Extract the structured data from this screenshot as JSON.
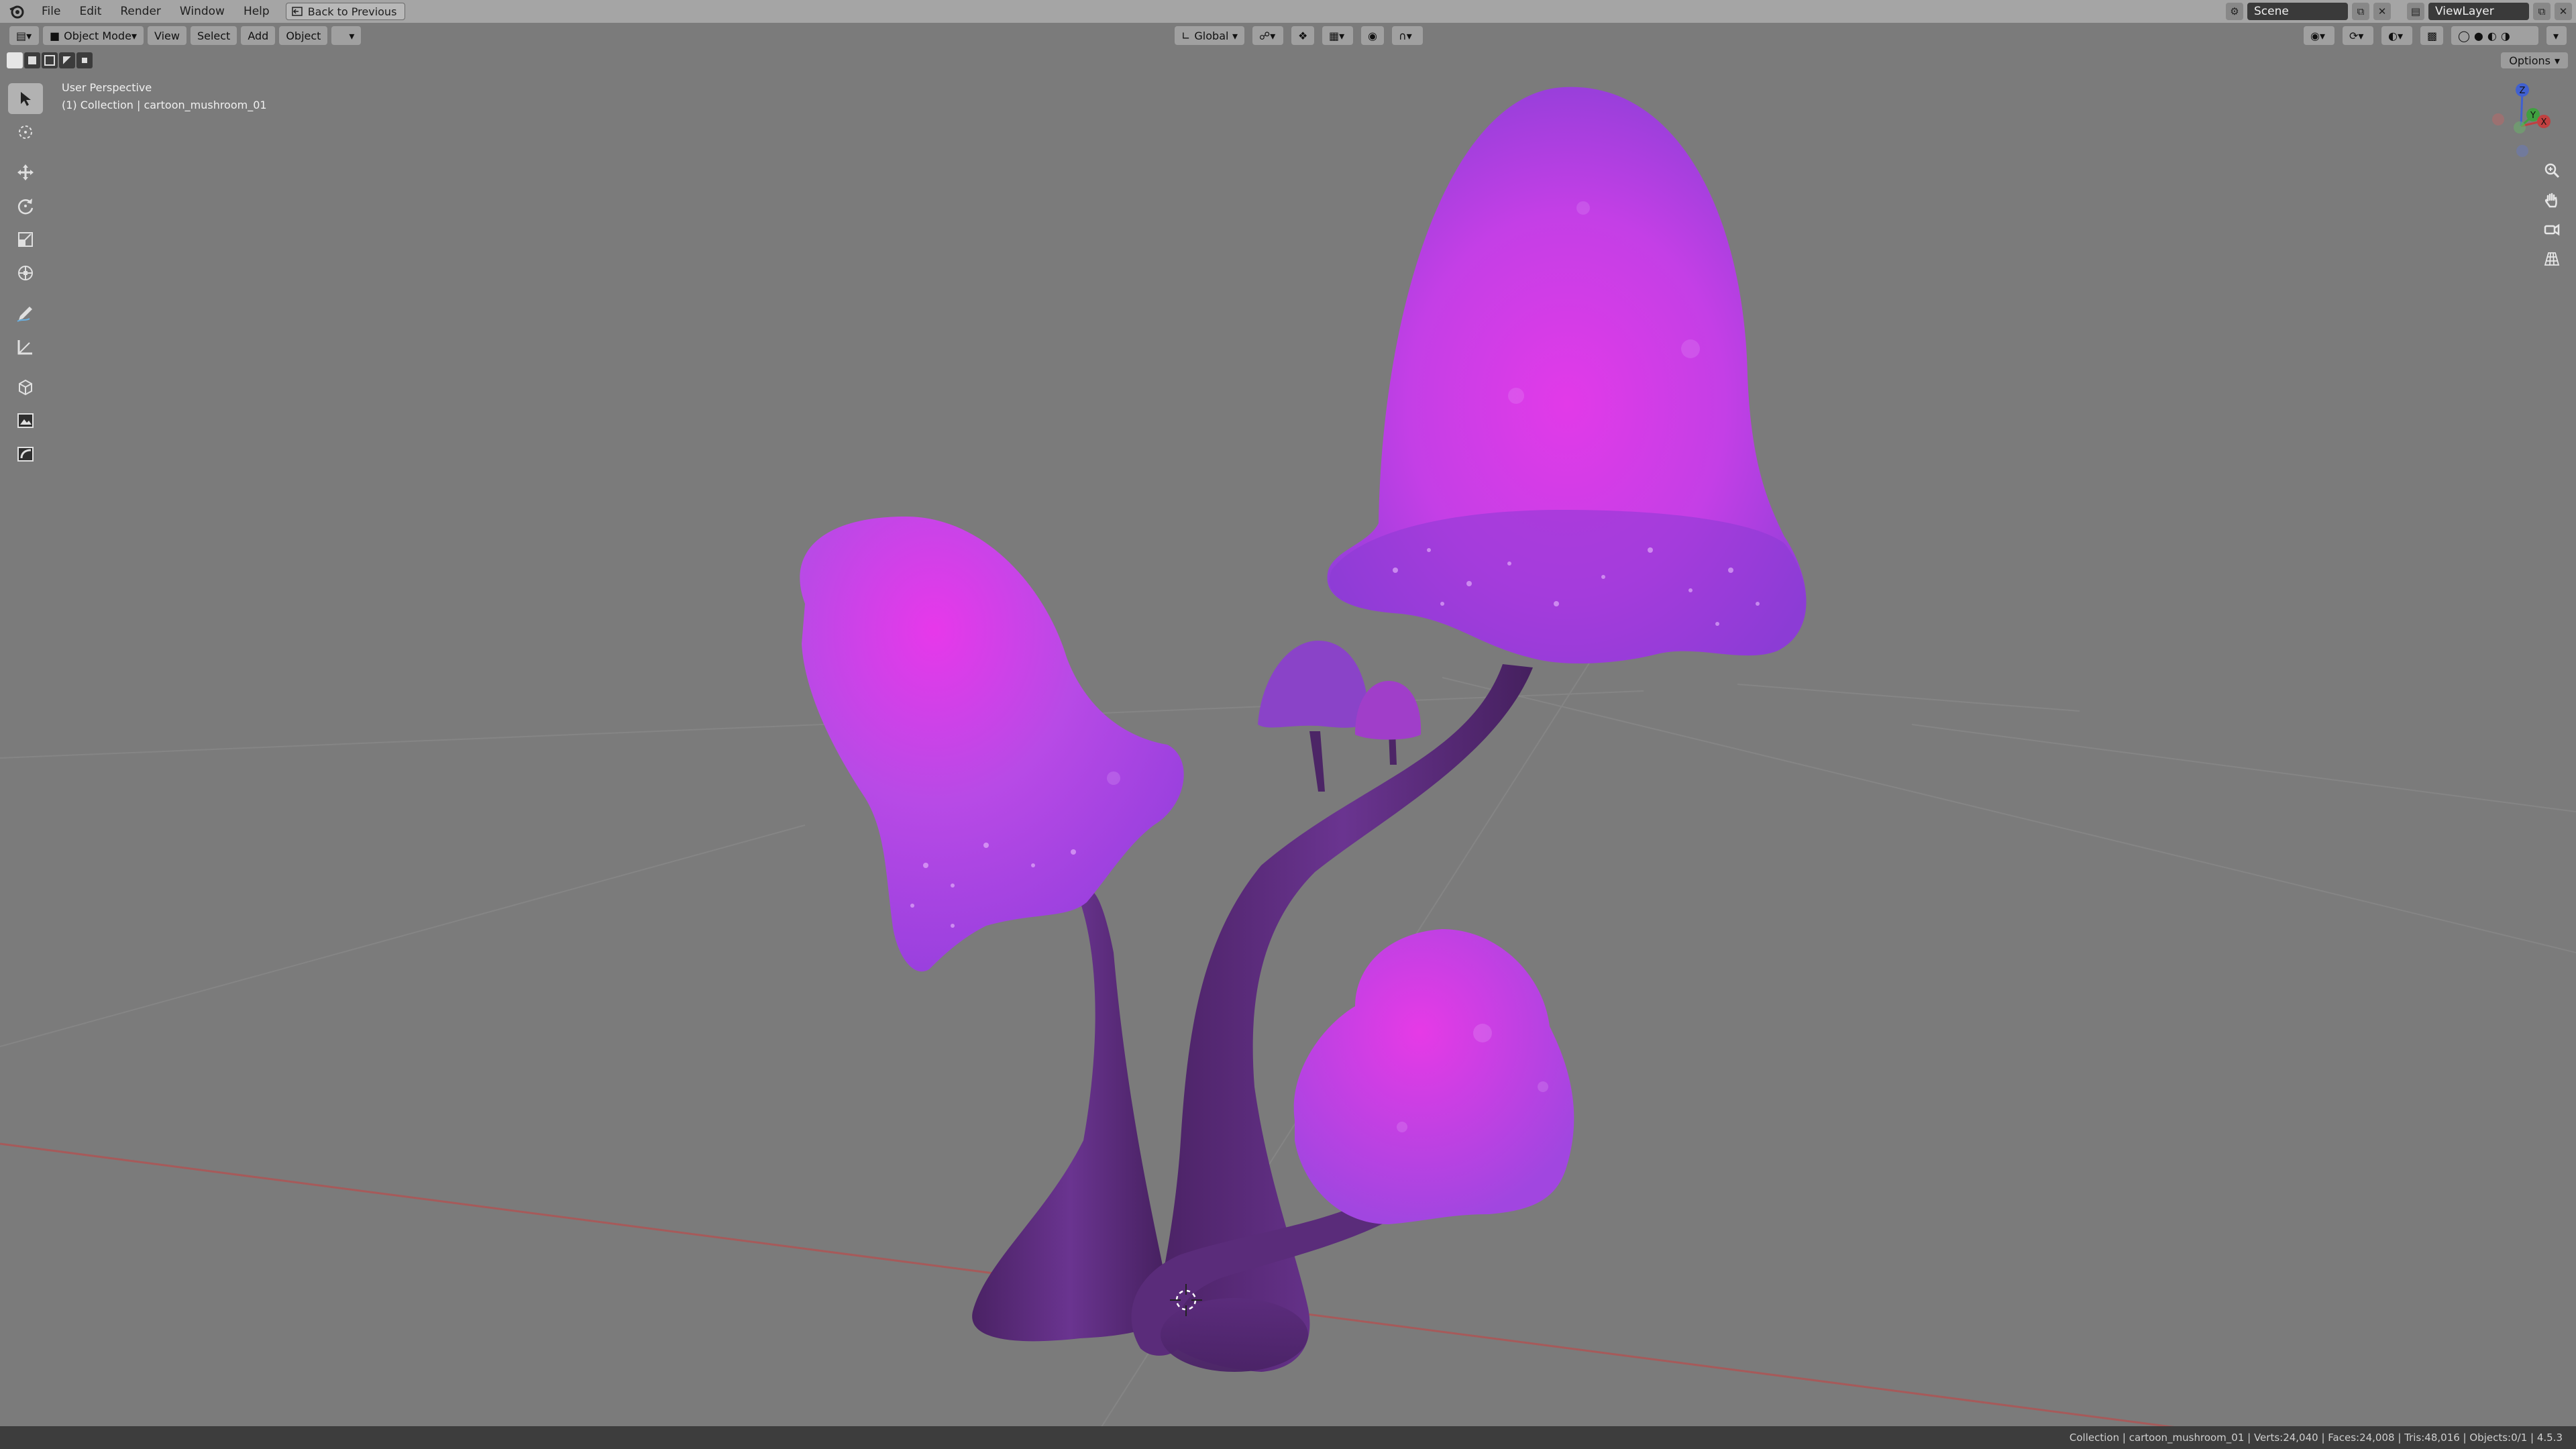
{
  "menubar": {
    "items": [
      "File",
      "Edit",
      "Render",
      "Window",
      "Help"
    ],
    "back_button": "Back to Previous",
    "scene": "Scene",
    "view_layer": "ViewLayer"
  },
  "viewport_header": {
    "mode": "Object Mode",
    "menus": [
      "View",
      "Select",
      "Add",
      "Object"
    ],
    "orientation": "Global"
  },
  "tool_settings": {
    "options_label": "Options"
  },
  "viewport": {
    "perspective_label": "User Perspective",
    "collection_label": "(1) Collection | cartoon_mushroom_01"
  },
  "gizmo": {
    "x_label": "X",
    "y_label": "Y",
    "z_label": "Z"
  },
  "statusbar": {
    "text": "Collection | cartoon_mushroom_01 | Verts:24,040 | Faces:24,008 | Tris:48,016 | Objects:0/1 | 4.5.3"
  },
  "colors": {
    "viewport_bg": "#7b7b7b",
    "cap_light": "#e032e6",
    "cap_base": "#a24fe4",
    "stem": "#5a2d78",
    "x_axis": "#c04040",
    "y_axis": "#40a040",
    "z_axis": "#4060d0"
  }
}
